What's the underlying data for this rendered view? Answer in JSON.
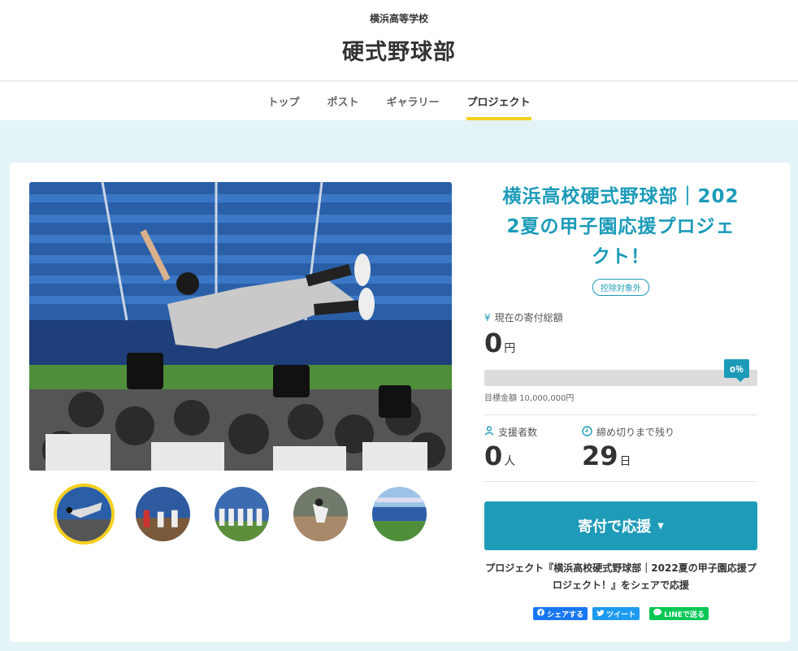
{
  "header": {
    "school_name": "横浜高等学校",
    "club_name": "硬式野球部"
  },
  "nav": {
    "tabs": [
      {
        "label": "トップ",
        "active": false
      },
      {
        "label": "ポスト",
        "active": false
      },
      {
        "label": "ギャラリー",
        "active": false
      },
      {
        "label": "プロジェクト",
        "active": true
      }
    ]
  },
  "gallery": {
    "main_image": "baseball-celebration-photo",
    "thumbnails": [
      {
        "name": "thumbnail-celebration",
        "active": true
      },
      {
        "name": "thumbnail-stadium-team",
        "active": false
      },
      {
        "name": "thumbnail-team-lineup",
        "active": false
      },
      {
        "name": "thumbnail-pitcher",
        "active": false
      },
      {
        "name": "thumbnail-stadium-wide",
        "active": false
      }
    ]
  },
  "project": {
    "title_lines": [
      "横浜高校硬式野球部｜202",
      "2夏の甲子園応援プロジェ",
      "クト！"
    ],
    "badge": "控除対象外",
    "donation": {
      "icon": "yen-icon",
      "label": "現在の寄付総額",
      "amount": "0",
      "unit": "円",
      "progress_percent": 0,
      "progress_label": "0％",
      "goal_text": "目標金額 10,000,000円"
    },
    "supporters": {
      "icon": "person-icon",
      "label": "支援者数",
      "count": "0",
      "unit": "人"
    },
    "deadline": {
      "icon": "clock-icon",
      "label": "締め切りまで残り",
      "count": "29",
      "unit": "日"
    },
    "cta": {
      "label": "寄付で応援",
      "caret": "▼"
    },
    "share": {
      "text": "プロジェクト『横浜高校硬式野球部｜2022夏の甲子園応援プロジェクト！』をシェアで応援",
      "facebook_label": "シェアする",
      "twitter_label": "ツイート",
      "line_label": "LINEで送る"
    }
  },
  "colors": {
    "accent": "#1c9bb8",
    "tab_underline": "#f6cf1a",
    "background": "#e3f3f6",
    "facebook": "#1877f2",
    "twitter": "#1d9bf0",
    "line": "#06c755"
  }
}
